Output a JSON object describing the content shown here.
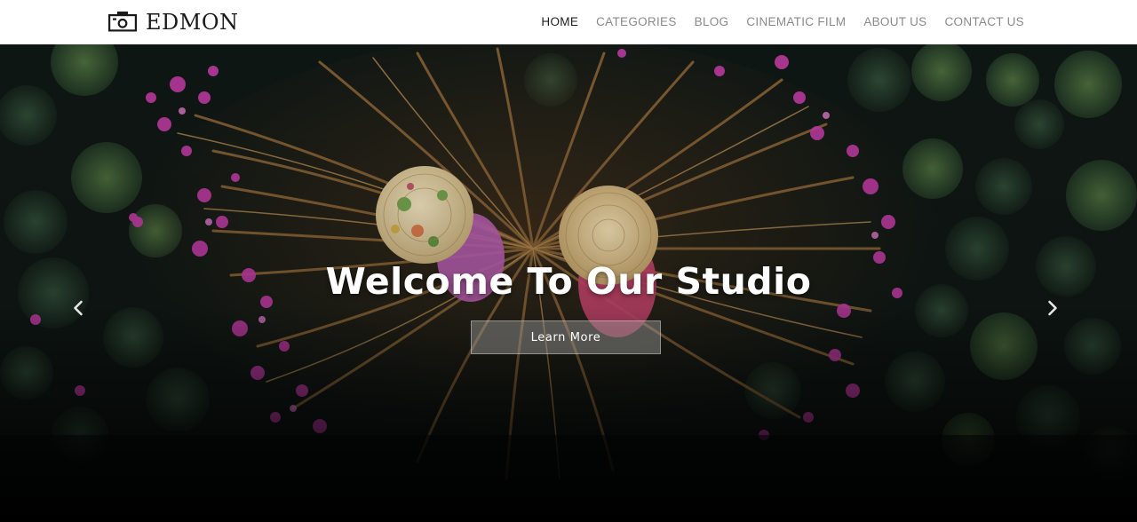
{
  "header": {
    "logo_text": "EDMON",
    "logo_icon": "camera-icon",
    "nav": [
      {
        "label": "HOME",
        "active": true
      },
      {
        "label": "CATEGORIES",
        "active": false
      },
      {
        "label": "BLOG",
        "active": false
      },
      {
        "label": "CINEMATIC FILM",
        "active": false
      },
      {
        "label": "ABOUT US",
        "active": false
      },
      {
        "label": "CONTACT US",
        "active": false
      }
    ]
  },
  "hero": {
    "title": "Welcome To Our Studio",
    "button_label": "Learn More",
    "prev_icon": "chevron-left-icon",
    "next_icon": "chevron-right-icon"
  },
  "colors": {
    "header_bg": "#ffffff",
    "nav_active": "#222222",
    "nav_inactive": "#8a8a8a",
    "lotus_pink": "#c23ca6",
    "water_dark": "#0e1412"
  }
}
